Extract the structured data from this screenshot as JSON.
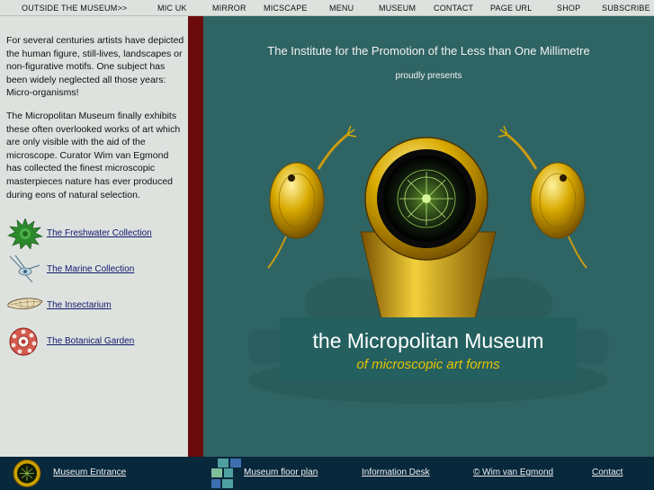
{
  "top_nav": [
    {
      "label": "OUTSIDE THE MUSEUM>>"
    },
    {
      "label": "MIC UK"
    },
    {
      "label": "MIRROR"
    },
    {
      "label": "MICSCAPE"
    },
    {
      "label": "MENU"
    },
    {
      "label": "MUSEUM"
    },
    {
      "label": "CONTACT"
    },
    {
      "label": "PAGE URL"
    },
    {
      "label": "SHOP"
    },
    {
      "label": "SUBSCRIBE"
    }
  ],
  "intro": {
    "p1": "For several centuries artists have depicted the human figure, still-lives, landscapes or non-figurative motifs. One subject has been widely neglected all those years: Micro-organisms!",
    "p2": "The Micropolitan Museum finally exhibits these often overlooked works of art which are only visible with the aid of the microscope. Curator Wim van Egmond has collected the finest microscopic masterpieces nature has ever produced during eons of natural selection."
  },
  "collections": [
    {
      "label": "The Freshwater Collection",
      "icon": "green-spiky-microorganism-icon"
    },
    {
      "label": "The Marine Collection",
      "icon": "marine-larva-icon"
    },
    {
      "label": "The Insectarium",
      "icon": "insect-wing-icon"
    },
    {
      "label": "The Botanical Garden",
      "icon": "red-pollen-cell-icon"
    }
  ],
  "hero": {
    "institute": "The Institute for the Promotion of the Less than One Millimetre",
    "presents": "proudly presents",
    "museum_name": "the Micropolitan Museum",
    "tagline": "of microscopic art forms"
  },
  "footer": {
    "entrance": "Museum Entrance",
    "floor_plan": "Museum floor plan",
    "info_desk": "Information Desk",
    "copyright": "© Wim van Egmond",
    "contact": "Contact"
  },
  "colors": {
    "nav_bg": "#dde2de",
    "main_bg": "#2f6464",
    "accent_red": "#6b0a0a",
    "footer_bg": "#08283c",
    "tagline_gold": "#e6c400",
    "link_blue": "#10186e"
  }
}
